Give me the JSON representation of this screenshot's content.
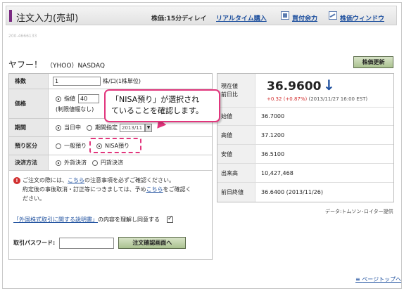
{
  "header": {
    "title": "注文入力(売却)",
    "price_note": "株価:15分ディレイ",
    "realtime_link": "リアルタイム購入",
    "buying_power_link": "買付余力",
    "price_window_link": "株価ウィンドウ"
  },
  "subline": "200-4666133",
  "stock": {
    "name": "ヤフー！",
    "code": "（YHOO）NASDAQ",
    "refresh_button": "株価更新"
  },
  "form": {
    "quantity": {
      "label": "株数",
      "value": "1",
      "unit": "株/口(1株単位)"
    },
    "price": {
      "label": "価格",
      "limit_label": "指値",
      "limit_value": "40",
      "limit_note": "(制限値幅なし)"
    },
    "period": {
      "label": "期間",
      "today_label": "当日中",
      "specified_label": "期間指定",
      "specified_value": "2013/11"
    },
    "custody": {
      "label": "預り区分",
      "general_label": "一般預り",
      "nisa_label": "NISA預り",
      "selected": "NISA預り"
    },
    "settlement": {
      "label": "決済方法",
      "foreign_label": "外貨決済",
      "yen_label": "円貨決済",
      "selected": "外貨決済"
    }
  },
  "notice": {
    "line1_pre": "ご注文の際には、",
    "line1_link": "こちら",
    "line1_post": "の注意事項を必ずご確認ください。",
    "line2_pre": "約定後の事後取消・訂正等につきましては、予め",
    "line2_link": "こちら",
    "line2_post": "をご確認く",
    "line3": "ださい。"
  },
  "agreement": {
    "link": "「外国株式取引に関する説明書」",
    "text": "の内容を理解し同意する",
    "checked": true
  },
  "password": {
    "label": "取引パスワード:",
    "value": "",
    "submit": "注文確認画面へ"
  },
  "quote": {
    "current_label_1": "現在値",
    "current_label_2": "前日比",
    "price": "36.9600",
    "change": "+0.32",
    "change_pct": "(+0.87%)",
    "timestamp": "(2013/11/27 16:00 EST)",
    "rows": [
      {
        "label": "始値",
        "value": "36.7000"
      },
      {
        "label": "高値",
        "value": "37.1200"
      },
      {
        "label": "安値",
        "value": "36.5100"
      },
      {
        "label": "出来高",
        "value": "10,427,468"
      },
      {
        "label": "前日終値",
        "value": "36.6400 (2013/11/26)"
      }
    ],
    "credit": "データ:トムソン･ロイター提供"
  },
  "callout": {
    "line1": "「NISA預り」が選択され",
    "line2": "ていることを確認します。"
  },
  "footer": {
    "page_top": "ページトップへ"
  },
  "colors": {
    "accent": "#e1357c",
    "link": "#1d4f9e",
    "header_bar": "#7a2a82",
    "button": "#aac290"
  }
}
